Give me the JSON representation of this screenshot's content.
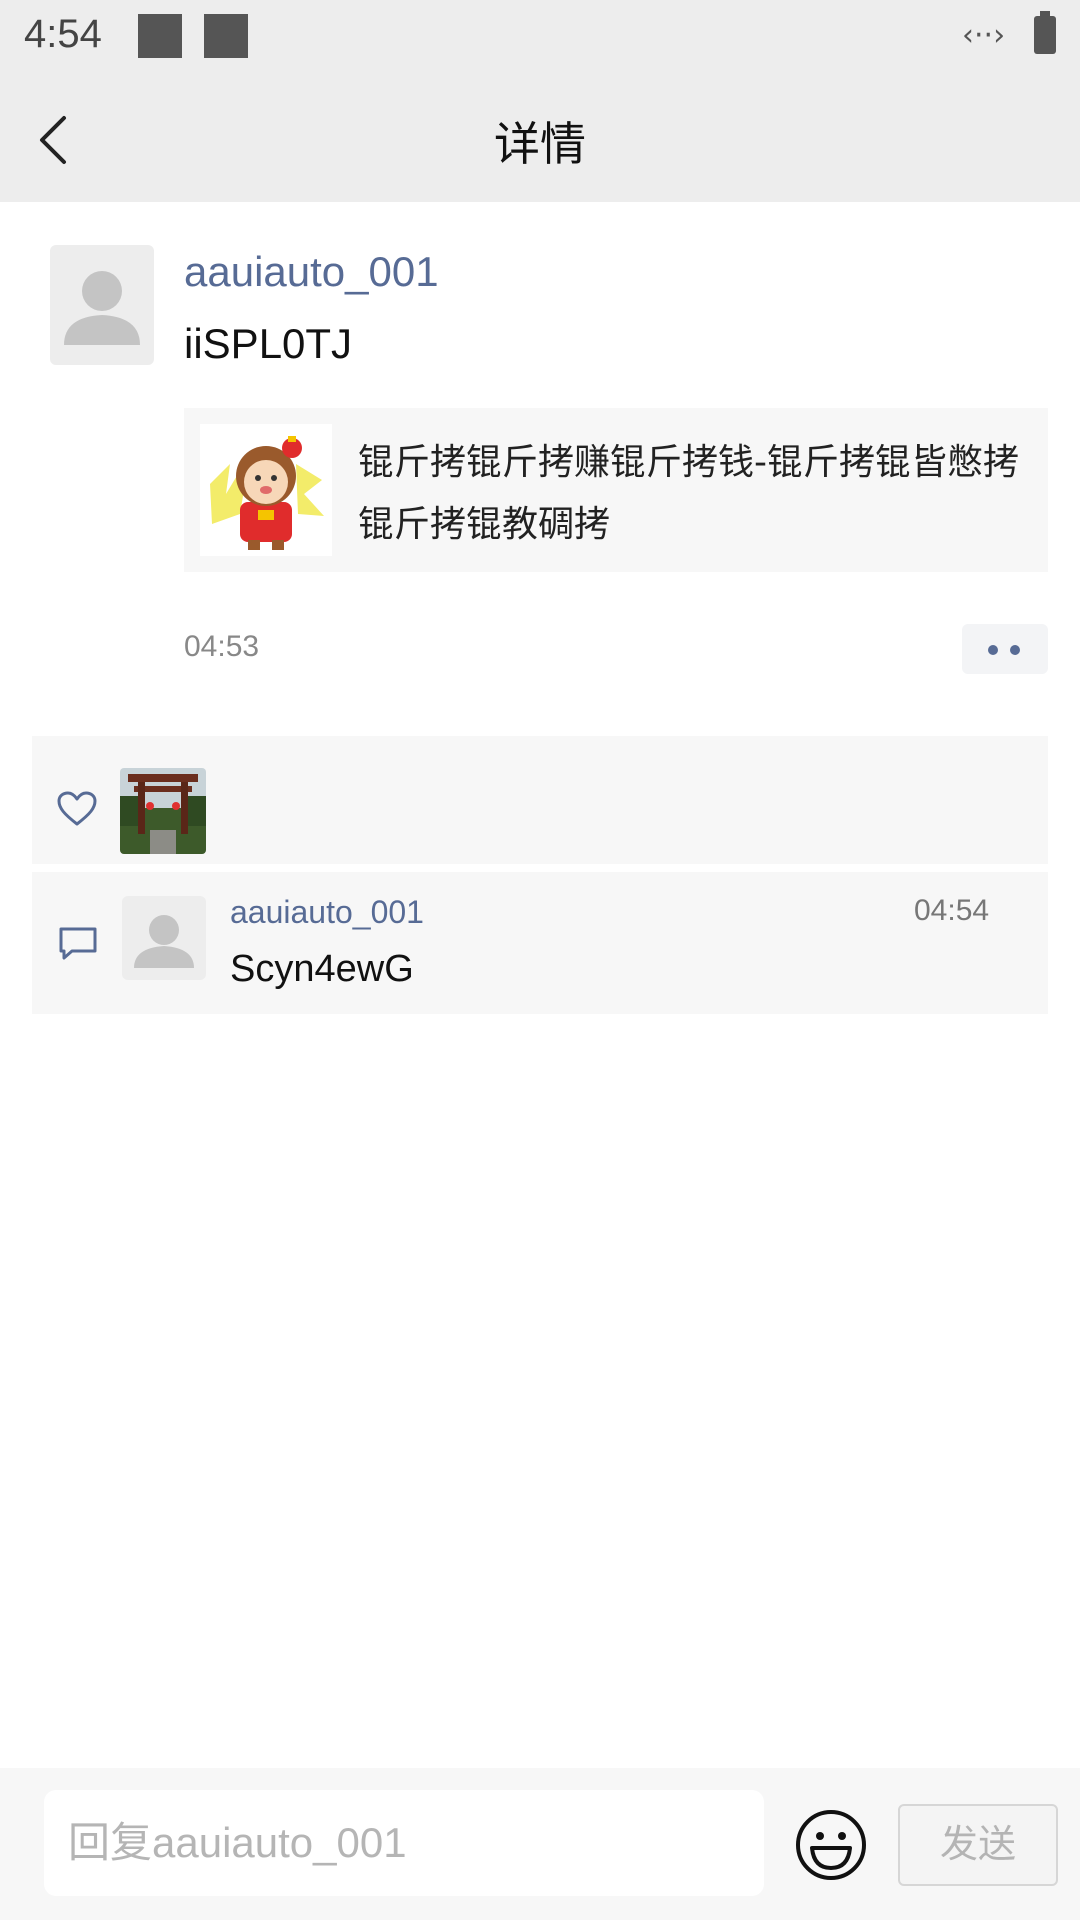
{
  "status_bar": {
    "time": "4:54",
    "data_indicator": "‹··›",
    "notification_icons": [
      "square-icon",
      "square-icon"
    ]
  },
  "header": {
    "title": "详情",
    "back_icon": "chevron-left-icon"
  },
  "post": {
    "author": "aauiauto_001",
    "text": "iiSPL0TJ",
    "shared_card_text": "锟斤拷锟斤拷赚锟斤拷钱-锟斤拷锟皆憋拷锟斤拷锟教碉拷",
    "time": "04:53",
    "more_icon": "more-dots-icon"
  },
  "likes": {
    "icon": "heart-icon"
  },
  "comments": [
    {
      "author": "aauiauto_001",
      "time": "04:54",
      "text": "Scyn4ewG"
    }
  ],
  "reply_bar": {
    "placeholder": "回复aauiauto_001",
    "value": "",
    "emoji_icon": "smiley-icon",
    "send_label": "发送"
  },
  "colors": {
    "accent_link": "#576b95",
    "bar_background": "#ededed",
    "panel_background": "#f7f7f7"
  }
}
